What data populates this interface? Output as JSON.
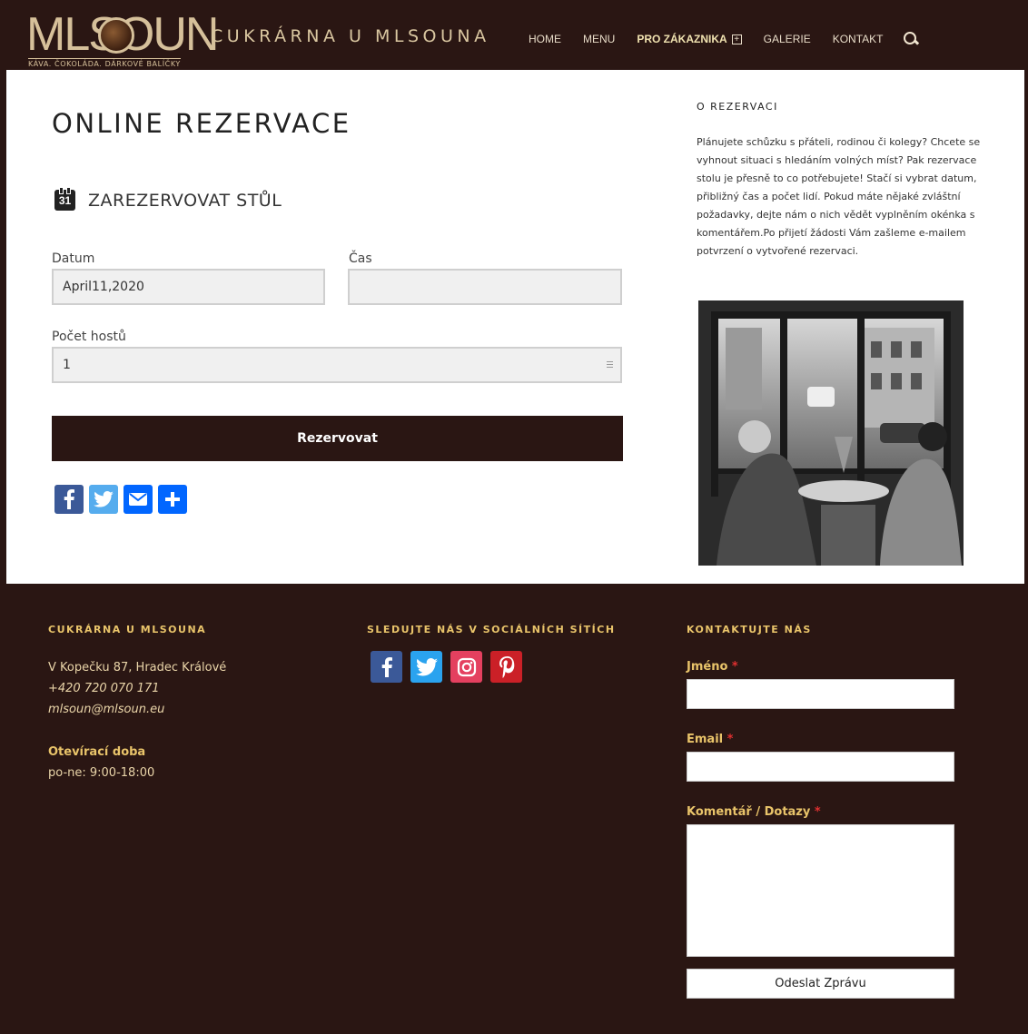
{
  "header": {
    "logo_text": "MLSOUN",
    "logo_tagline": "KÁVA. ČOKOLÁDA. DÁRKOVÉ BALÍČKY",
    "site_title": "CUKRÁRNA U MLSOUNA",
    "nav": [
      "HOME",
      "MENU",
      "PRO ZÁKAZNIKA",
      "GALERIE",
      "KONTAKT"
    ],
    "nav_plus": "+",
    "search_icon": "search-icon"
  },
  "main": {
    "page_title": "ONLINE REZERVACE",
    "section_title": "ZAREZERVOVAT STŮL",
    "calendar_icon_text": "31",
    "fields": {
      "date_label": "Datum",
      "date_value": "April11,2020",
      "time_label": "Čas",
      "time_value": "",
      "guests_label": "Počet hostů",
      "guests_value": "1"
    },
    "reserve_button": "Rezervovat",
    "share": [
      {
        "name": "facebook-icon",
        "color": "#3b5998"
      },
      {
        "name": "twitter-icon",
        "color": "#55acee"
      },
      {
        "name": "email-icon",
        "color": "#0166ff"
      },
      {
        "name": "share-plus-icon",
        "color": "#0166ff"
      }
    ]
  },
  "sidebar": {
    "title": "O REZERVACI",
    "text": "Plánujete schůzku s přáteli, rodinou či kolegy? Chcete se vyhnout situaci s hledáním volných míst? Pak rezervace stolu je přesně to co potřebujete! Stačí si vybrat datum, přibližný čas a počet lidí. Pokud máte nějaké zvláštní požadavky, dejte nám o nich vědět vyplněním okénka s komentářem.Po přijetí žádosti Vám zašleme e-mailem potvrzení o vytvořené rezervaci."
  },
  "footer": {
    "col1_title": "CUKRÁRNA U MLSOUNA",
    "address": "V Kopečku 87, Hradec Králové",
    "phone": "+420 720 070 171",
    "email": "mlsoun@mlsoun.eu",
    "hours_title": "Otevírací doba",
    "hours": "po-ne: 9:00-18:00",
    "col2_title": "SLEDUJTE NÁS V SOCIÁLNÍCH SÍTÍCH",
    "social": [
      {
        "name": "facebook-icon",
        "color": "#3b5998"
      },
      {
        "name": "twitter-icon",
        "color": "#2aa3ef"
      },
      {
        "name": "instagram-icon",
        "color": "#e4405f"
      },
      {
        "name": "pinterest-icon",
        "color": "#cb2027"
      }
    ],
    "col3_title": "KONTAKTUJTE NÁS",
    "name_label": "Jméno",
    "email_label": "Email",
    "comment_label": "Komentář / Dotazy",
    "required_mark": "*",
    "send_button": "Odeslat Zprávu"
  },
  "colors": {
    "brand_dark": "#2a1613",
    "footer_accent": "#e9c46a",
    "logo_gold": "#d6c09a"
  }
}
